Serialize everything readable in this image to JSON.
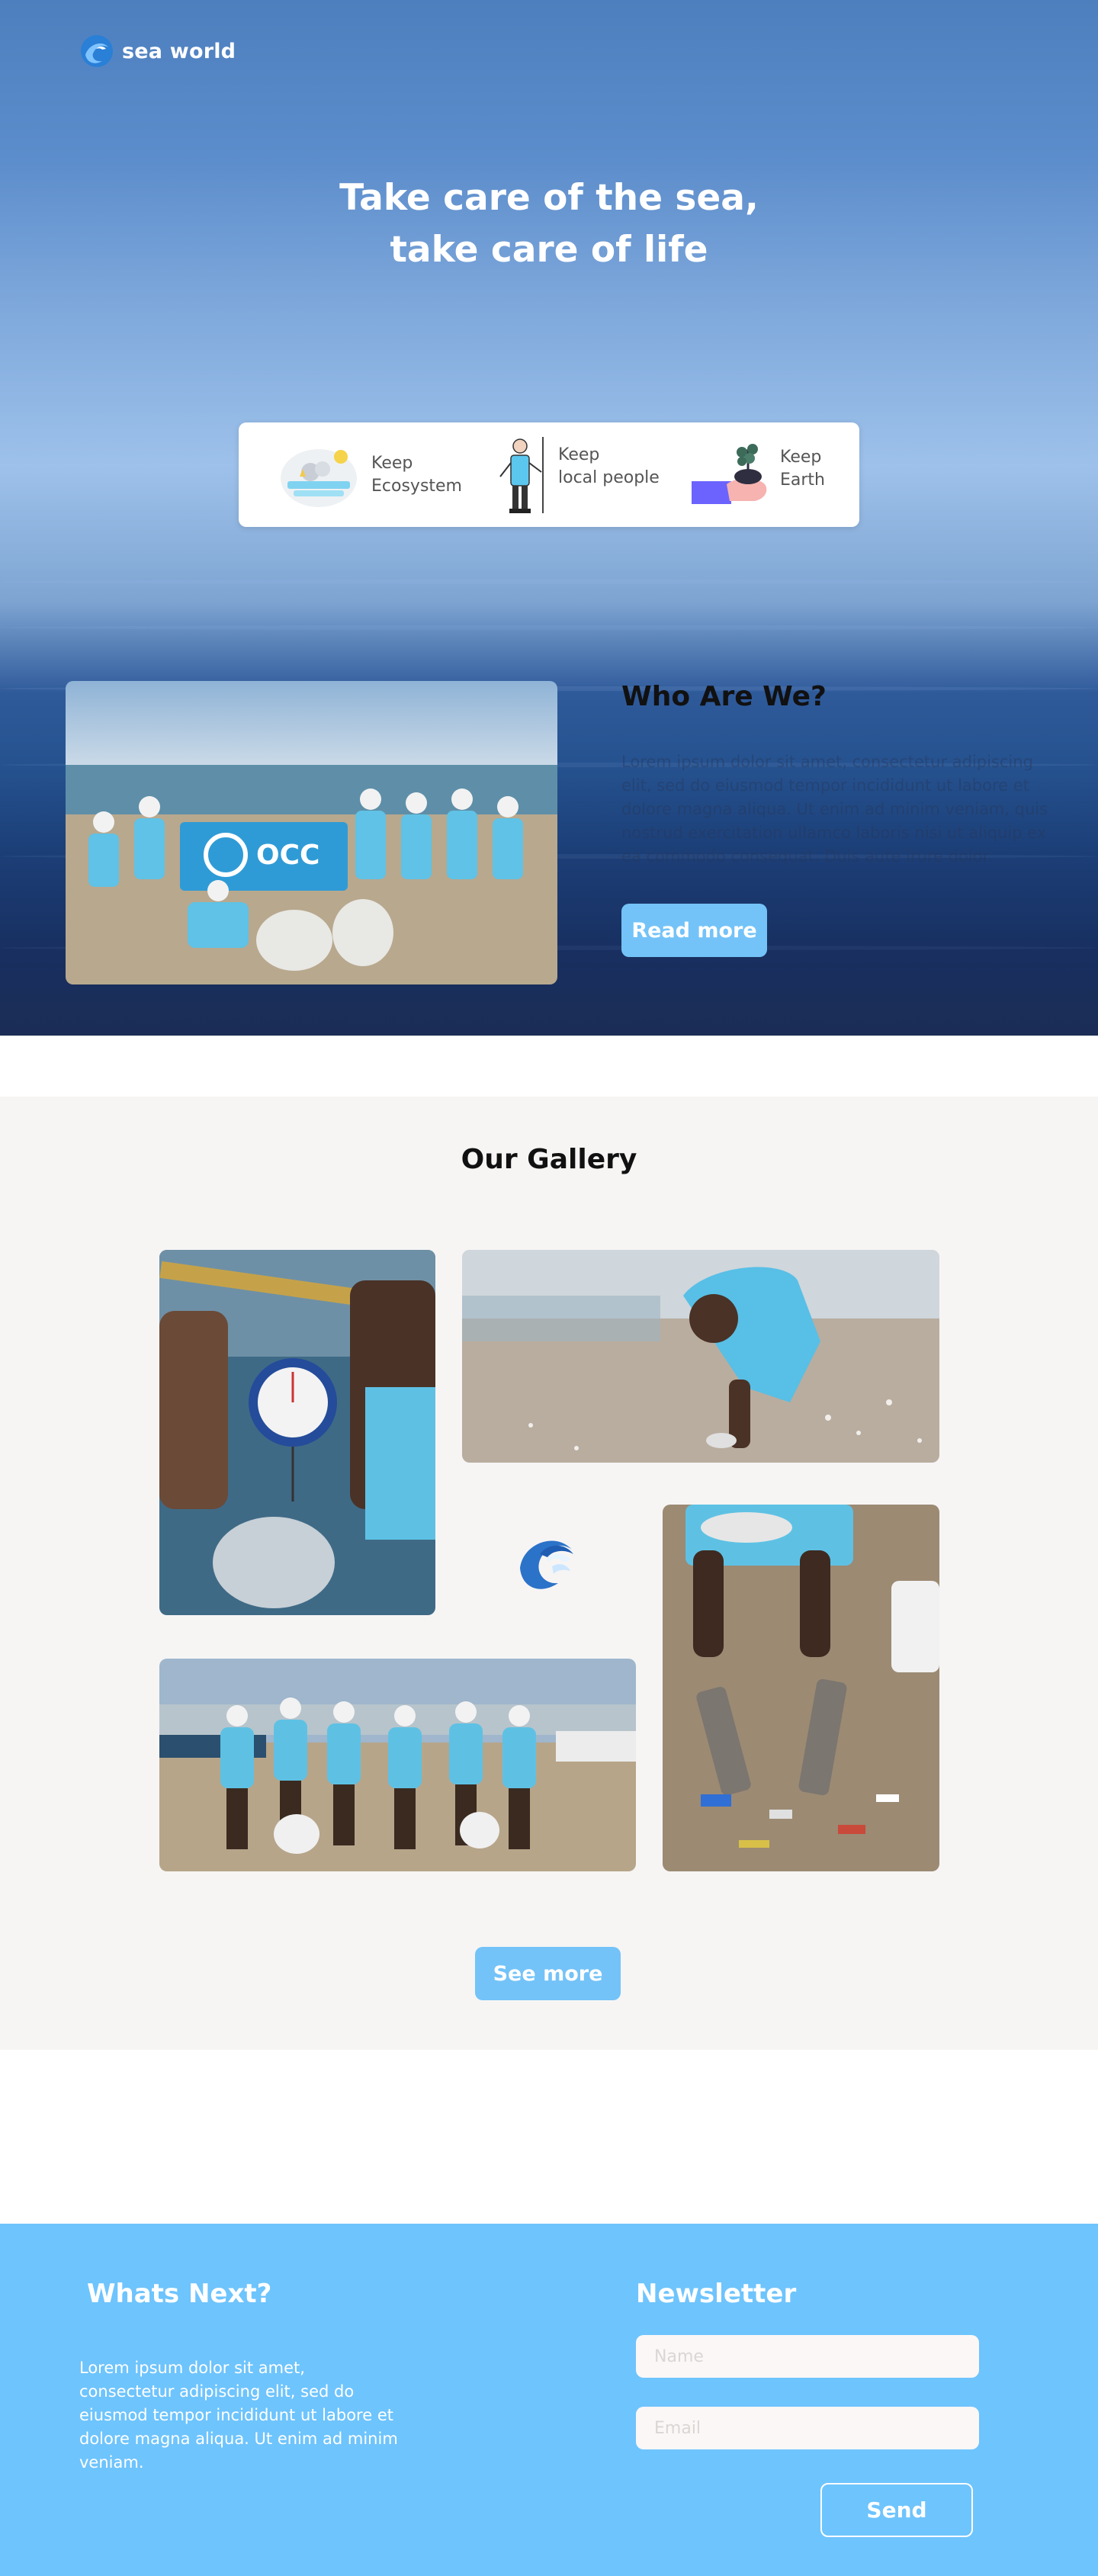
{
  "brand": {
    "name": "sea world"
  },
  "hero": {
    "title_line1": "Take care of the sea,",
    "title_line2": "take care of life"
  },
  "features": [
    {
      "line1": "Keep",
      "line2": "Ecosystem",
      "icon": "ecosystem-illustration"
    },
    {
      "line1": "Keep",
      "line2": "local people",
      "icon": "fisherman-illustration"
    },
    {
      "line1": "Keep",
      "line2": "Earth",
      "icon": "earth-plant-illustration"
    }
  ],
  "who": {
    "title": "Who Are We?",
    "body": "Lorem ipsum dolor sit amet, consectetur adipiscing elit, sed do eiusmod tempor incididunt ut labore et dolore magna aliqua. Ut enim ad minim veniam, quis nostrud exercitation ullamco laboris nisi ut aliquip ex ea commodo consequat. Duis aute irure dolor.",
    "button": "Read more"
  },
  "gallery": {
    "title": "Our Gallery",
    "button": "See more"
  },
  "footer": {
    "title": "Whats Next?",
    "body": "Lorem ipsum dolor sit amet, consectetur adipiscing elit, sed do eiusmod tempor incididunt ut labore et dolore magna aliqua. Ut enim ad minim veniam.",
    "newsletter_title": "Newsletter",
    "name_placeholder": "Name",
    "email_placeholder": "Email",
    "send": "Send"
  },
  "colors": {
    "accent": "#73c3f8",
    "footer_bg": "#6ec4fd",
    "gallery_bg": "#f6f5f4"
  }
}
